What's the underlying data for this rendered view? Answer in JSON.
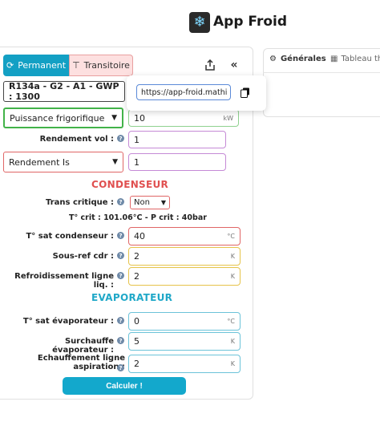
{
  "header": {
    "title": "App Froid",
    "logo_icon": "snowflake-icon"
  },
  "tabs": {
    "permanent": {
      "label": "Permanent",
      "icon": "refresh-icon"
    },
    "transitoire": {
      "label": "Transitoire",
      "icon": "sliders-icon"
    }
  },
  "toolbar": {
    "share_icon": "share-icon",
    "collapse_icon": "double-chevron-left-icon",
    "collapse_glyph": "«"
  },
  "share_popover": {
    "url": "https://app-froid.mathi",
    "copy_icon": "copy-icon"
  },
  "fluid_select": {
    "value": "R134a - G2 - A1 - GWP : 1300"
  },
  "puissance": {
    "select": "Puissance frigorifique",
    "value": "10",
    "unit": "kW"
  },
  "rendement_vol": {
    "label": "Rendement vol :",
    "value": "1"
  },
  "rendement_is": {
    "select": "Rendement Is",
    "value": "1"
  },
  "condenseur": {
    "title": "CONDENSEUR",
    "trans_critique": {
      "label": "Trans critique :",
      "value": "Non"
    },
    "tcrit_text": "T° crit : 101.06°C - P crit : 40bar",
    "t_sat": {
      "label": "T° sat condenseur :",
      "value": "40",
      "unit": "°C"
    },
    "sous_ref": {
      "label": "Sous-ref cdr :",
      "value": "2",
      "unit": "K"
    },
    "refroid": {
      "label": "Refroidissement ligne liq. :",
      "value": "2",
      "unit": "K"
    }
  },
  "evaporateur": {
    "title": "EVAPORATEUR",
    "t_sat": {
      "label": "T° sat évaporateur :",
      "value": "0",
      "unit": "°C"
    },
    "surchauffe": {
      "label": "Surchauffe évaporateur :",
      "value": "5",
      "unit": "K"
    },
    "echauffement": {
      "label": "Echauffement ligne aspiration :",
      "value": "2",
      "unit": "K"
    }
  },
  "calc_button": {
    "label": "Calculer !"
  },
  "right_tabs": {
    "generales": "Générales",
    "tableau": "Tableau th"
  },
  "help_glyph": "?",
  "colors": {
    "accent": "#13a0c4",
    "condenseur": "#e05050",
    "evaporateur": "#20a8c8"
  }
}
